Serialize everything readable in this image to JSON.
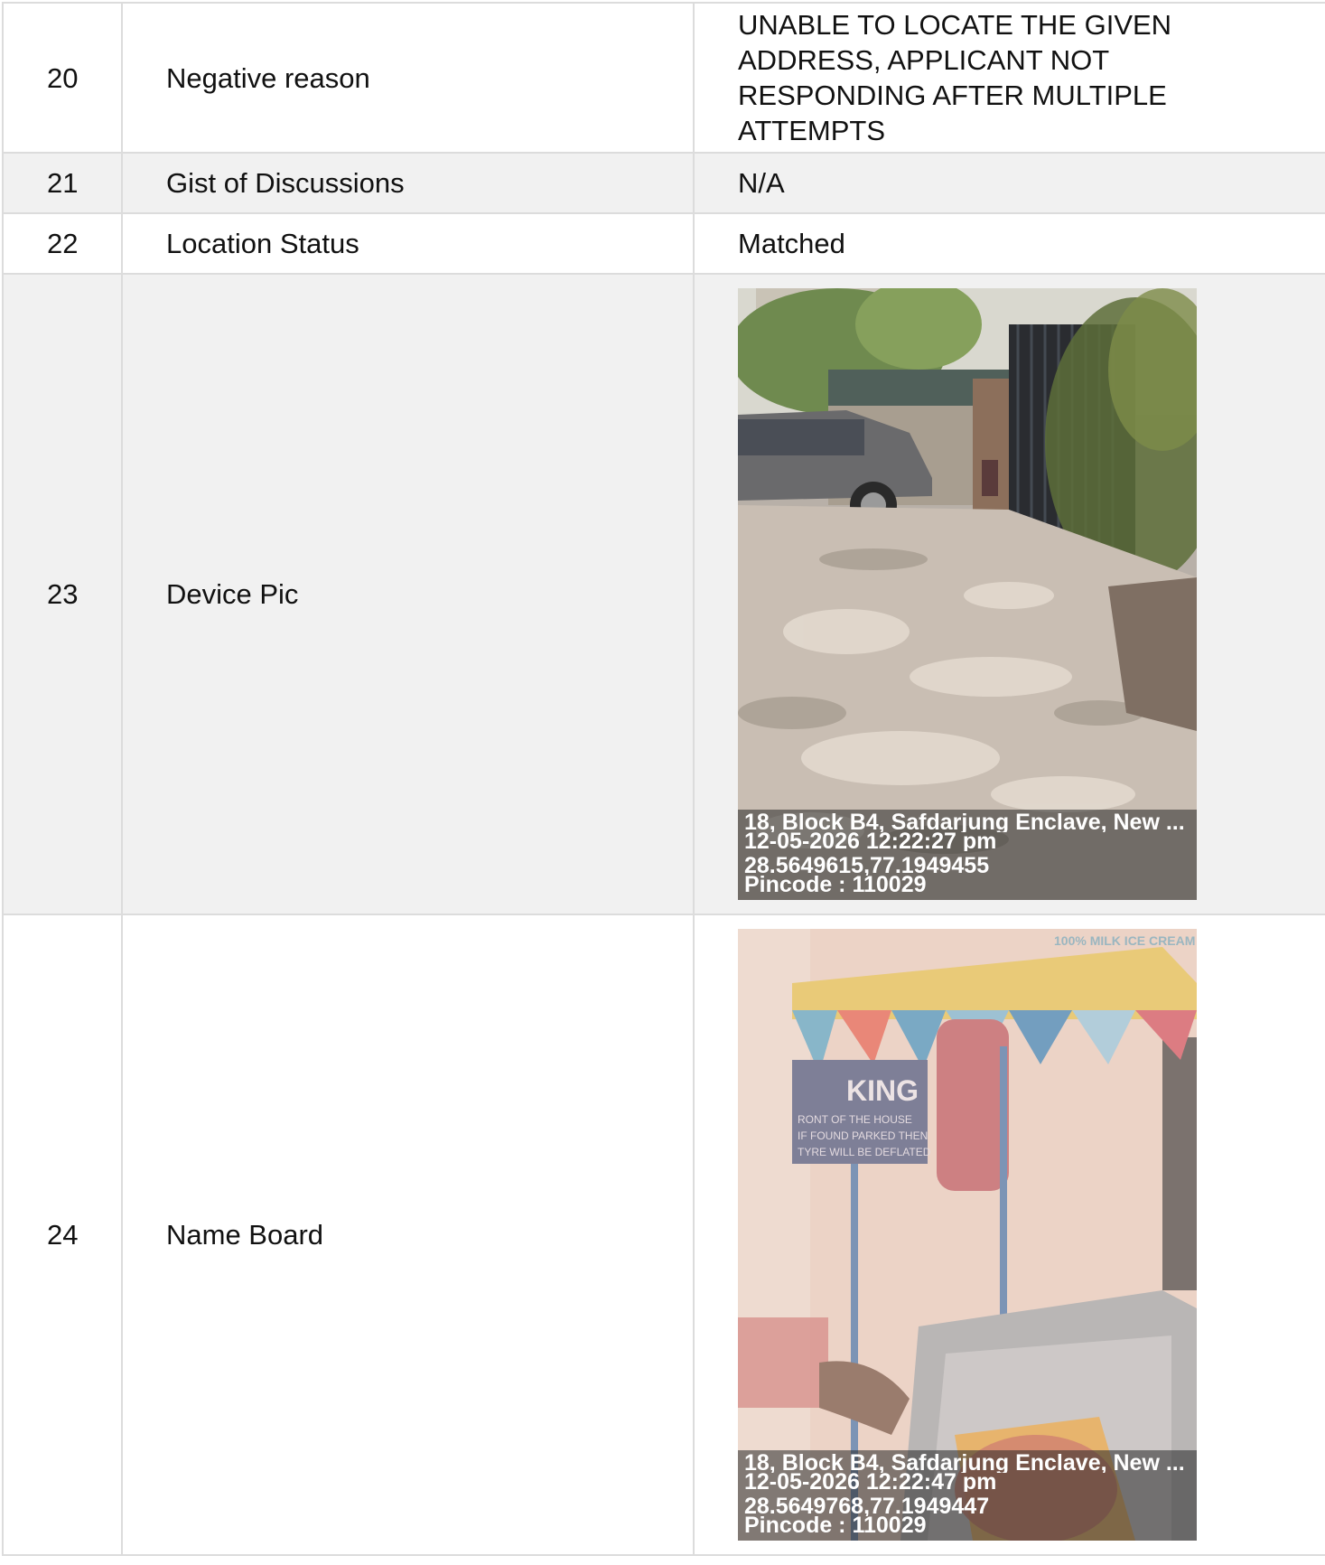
{
  "rows": [
    {
      "num": "20",
      "label": "Negative reason",
      "value_lines": [
        "UNABLE TO LOCATE THE GIVEN",
        "ADDRESS, APPLICANT NOT",
        "RESPONDING AFTER MULTIPLE",
        "ATTEMPTS"
      ]
    },
    {
      "num": "21",
      "label": "Gist of Discussions",
      "value": "N/A"
    },
    {
      "num": "22",
      "label": "Location Status",
      "value": "Matched"
    },
    {
      "num": "23",
      "label": "Device Pic",
      "photo": {
        "address": "18, Block B4, Safdarjung Enclave, New ...",
        "datetime": "12-05-2026 12:22:27 pm",
        "coords": "28.5649615,77.1949455",
        "pincode": "Pincode : 110029"
      }
    },
    {
      "num": "24",
      "label": "Name Board",
      "photo": {
        "address": "18, Block B4, Safdarjung Enclave, New ...",
        "datetime": "12-05-2026 12:22:47 pm",
        "coords": "28.5649768,77.1949447",
        "pincode": "Pincode : 110029",
        "sign_lines": [
          "KING",
          "RONT OF THE HOUSE",
          "IF FOUND PARKED THEN",
          "TYRE WILL BE DEFLATED"
        ],
        "canopy_text": "100% MILK ICE CREAM"
      }
    }
  ]
}
